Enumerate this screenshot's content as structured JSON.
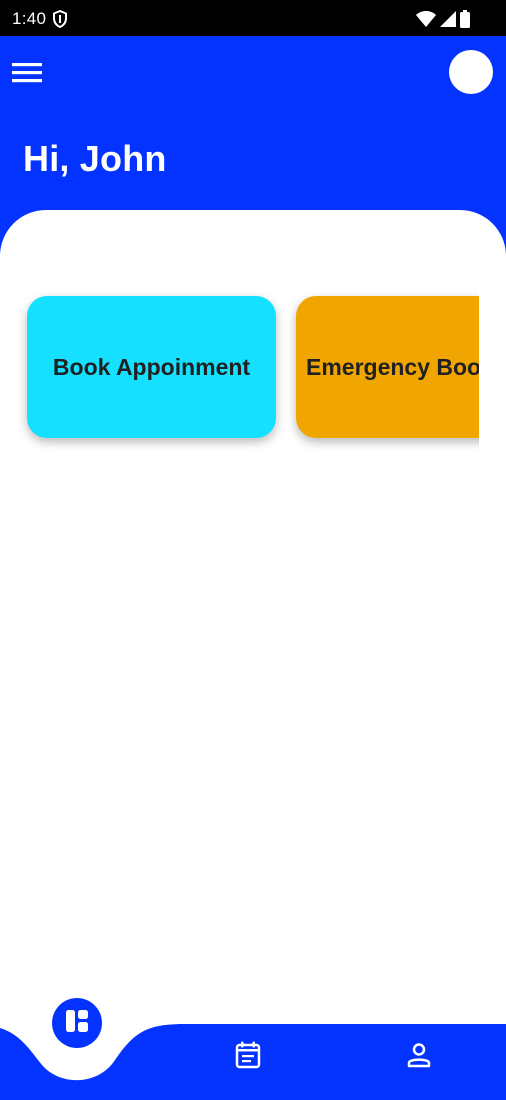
{
  "status_bar": {
    "time": "1:40",
    "icons": [
      "shield-icon",
      "wifi-icon",
      "signal-icon",
      "battery-icon"
    ]
  },
  "header": {
    "greeting": "Hi, John",
    "menu_icon": "hamburger-menu-icon",
    "avatar": "avatar"
  },
  "cards": [
    {
      "label": "Book Appoinment",
      "color": "#15e0ff"
    },
    {
      "label": "Emergency Boo",
      "color": "#f0a500"
    }
  ],
  "bottom_nav": {
    "items": [
      {
        "icon": "dashboard-icon",
        "active": true
      },
      {
        "icon": "calendar-icon",
        "active": false
      },
      {
        "icon": "profile-icon",
        "active": false
      }
    ]
  },
  "colors": {
    "primary": "#0433ff",
    "status_bar": "#000000",
    "surface": "#ffffff",
    "card_book": "#15e0ff",
    "card_emergency": "#f0a500"
  }
}
